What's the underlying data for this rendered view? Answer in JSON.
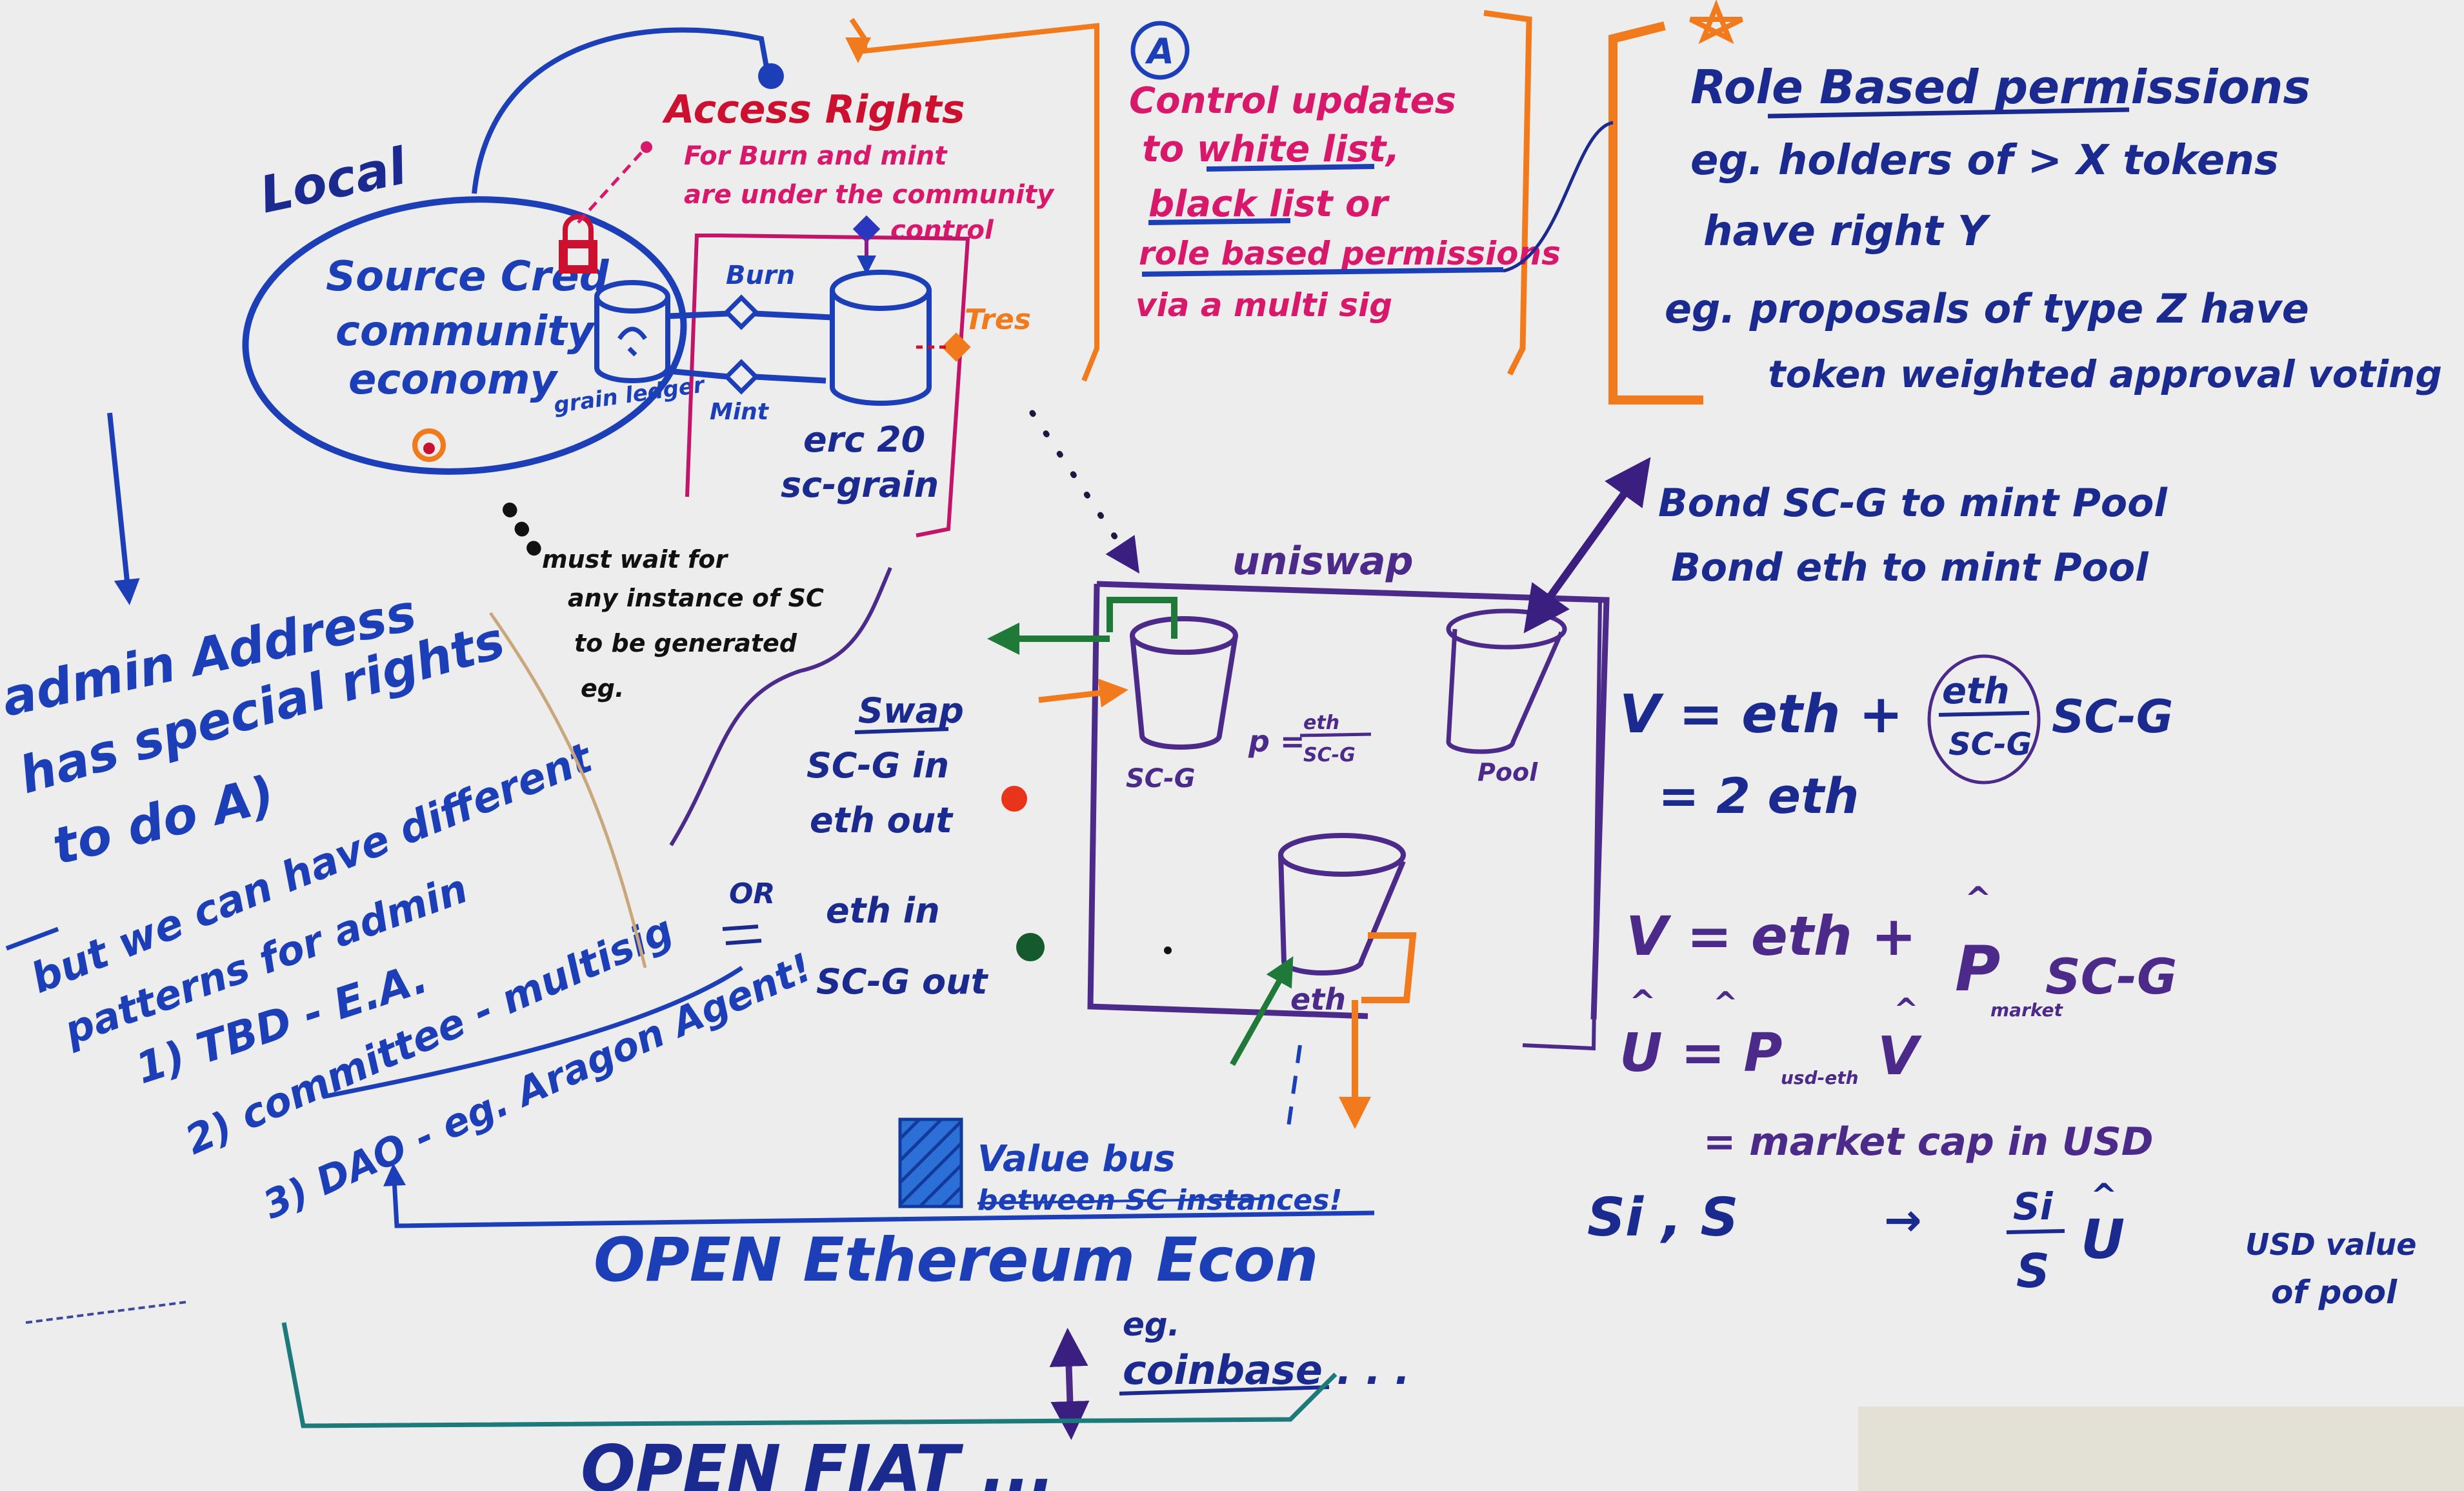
{
  "colors": {
    "blue": "#1c3fb8",
    "navy": "#1a2a8f",
    "purple": "#4b2a8a",
    "pink": "#d8186a",
    "red": "#cc1030",
    "orange": "#f07a1c",
    "green": "#1f7a3a",
    "board": "#ededed"
  },
  "left_group": {
    "local_label": "Local",
    "ellipse_lines": [
      "Source Cred",
      "community",
      "economy"
    ],
    "grain_ledger": "grain ledger"
  },
  "access_rights": {
    "title": "Access Rights",
    "note_lines": [
      "For Burn and mint",
      "are under the community",
      "control"
    ]
  },
  "contract_box": {
    "burn": "Burn",
    "mint": "Mint",
    "erc20": "erc 20",
    "sc_grain": "sc-grain",
    "treasury": "Tres"
  },
  "control_updates": {
    "marker": "A",
    "lines": [
      "Control updates",
      "to white list,",
      "black list or",
      "role based permissions",
      "via a multi sig"
    ]
  },
  "role_based": {
    "title": "Role Based permissions",
    "lines": [
      "eg. holders of  > X  tokens",
      "have right  Y",
      "eg. proposals of type Z  have",
      "token weighted approval voting"
    ]
  },
  "admin_notes": {
    "lines": [
      "admin Address",
      "has special rights",
      "to do  A)",
      "but we can have different",
      "patterns for admin",
      "1) TBD - E.A.",
      "2) committee - multisig",
      "3) DAO - eg. Aragon Agent!"
    ]
  },
  "must_wait": {
    "lines": [
      "must wait for",
      "any instance of SC",
      "to be generated",
      "eg."
    ]
  },
  "uniswap": {
    "title": "uniswap",
    "sc_g": "SC-G",
    "pool": "Pool",
    "eth": "eth",
    "price_p": "p =",
    "price_num": "eth",
    "price_den": "SC-G"
  },
  "swap": {
    "title": "Swap",
    "line1": "SC-G in",
    "line2": "eth out",
    "or": "OR",
    "line3": "eth in",
    "line4": "SC-G out"
  },
  "bond": {
    "line1": "Bond SC-G to mint Pool",
    "line2": "Bond eth to mint Pool"
  },
  "formulas": {
    "v1": "V = eth +",
    "v1_frac_num": "eth",
    "v1_frac_den": "SC-G",
    "v1_tail": "SC-G",
    "v1_result": "= 2 eth",
    "v2": "V = eth +",
    "v2_p": "P",
    "v2_p_sub": "market",
    "v2_tail": "SC-G",
    "v3": "U = P",
    "v3_sub": "usd-eth",
    "v3_tail": "V",
    "market_cap": "= market cap in USD",
    "si_s": "Si , S",
    "arrow": "→",
    "frac_num": "Si",
    "frac_den": "S",
    "u_hat": "U",
    "usd_value": "USD value",
    "of_pool": "of pool"
  },
  "value_bus": {
    "line1": "Value bus",
    "line2": "between SC instances!"
  },
  "open_eth": "OPEN  Ethereum  Econ",
  "coinbase": {
    "eg": "eg.",
    "name": "coinbase . . ."
  },
  "bottom_cut": "OPEN FIAT ..."
}
